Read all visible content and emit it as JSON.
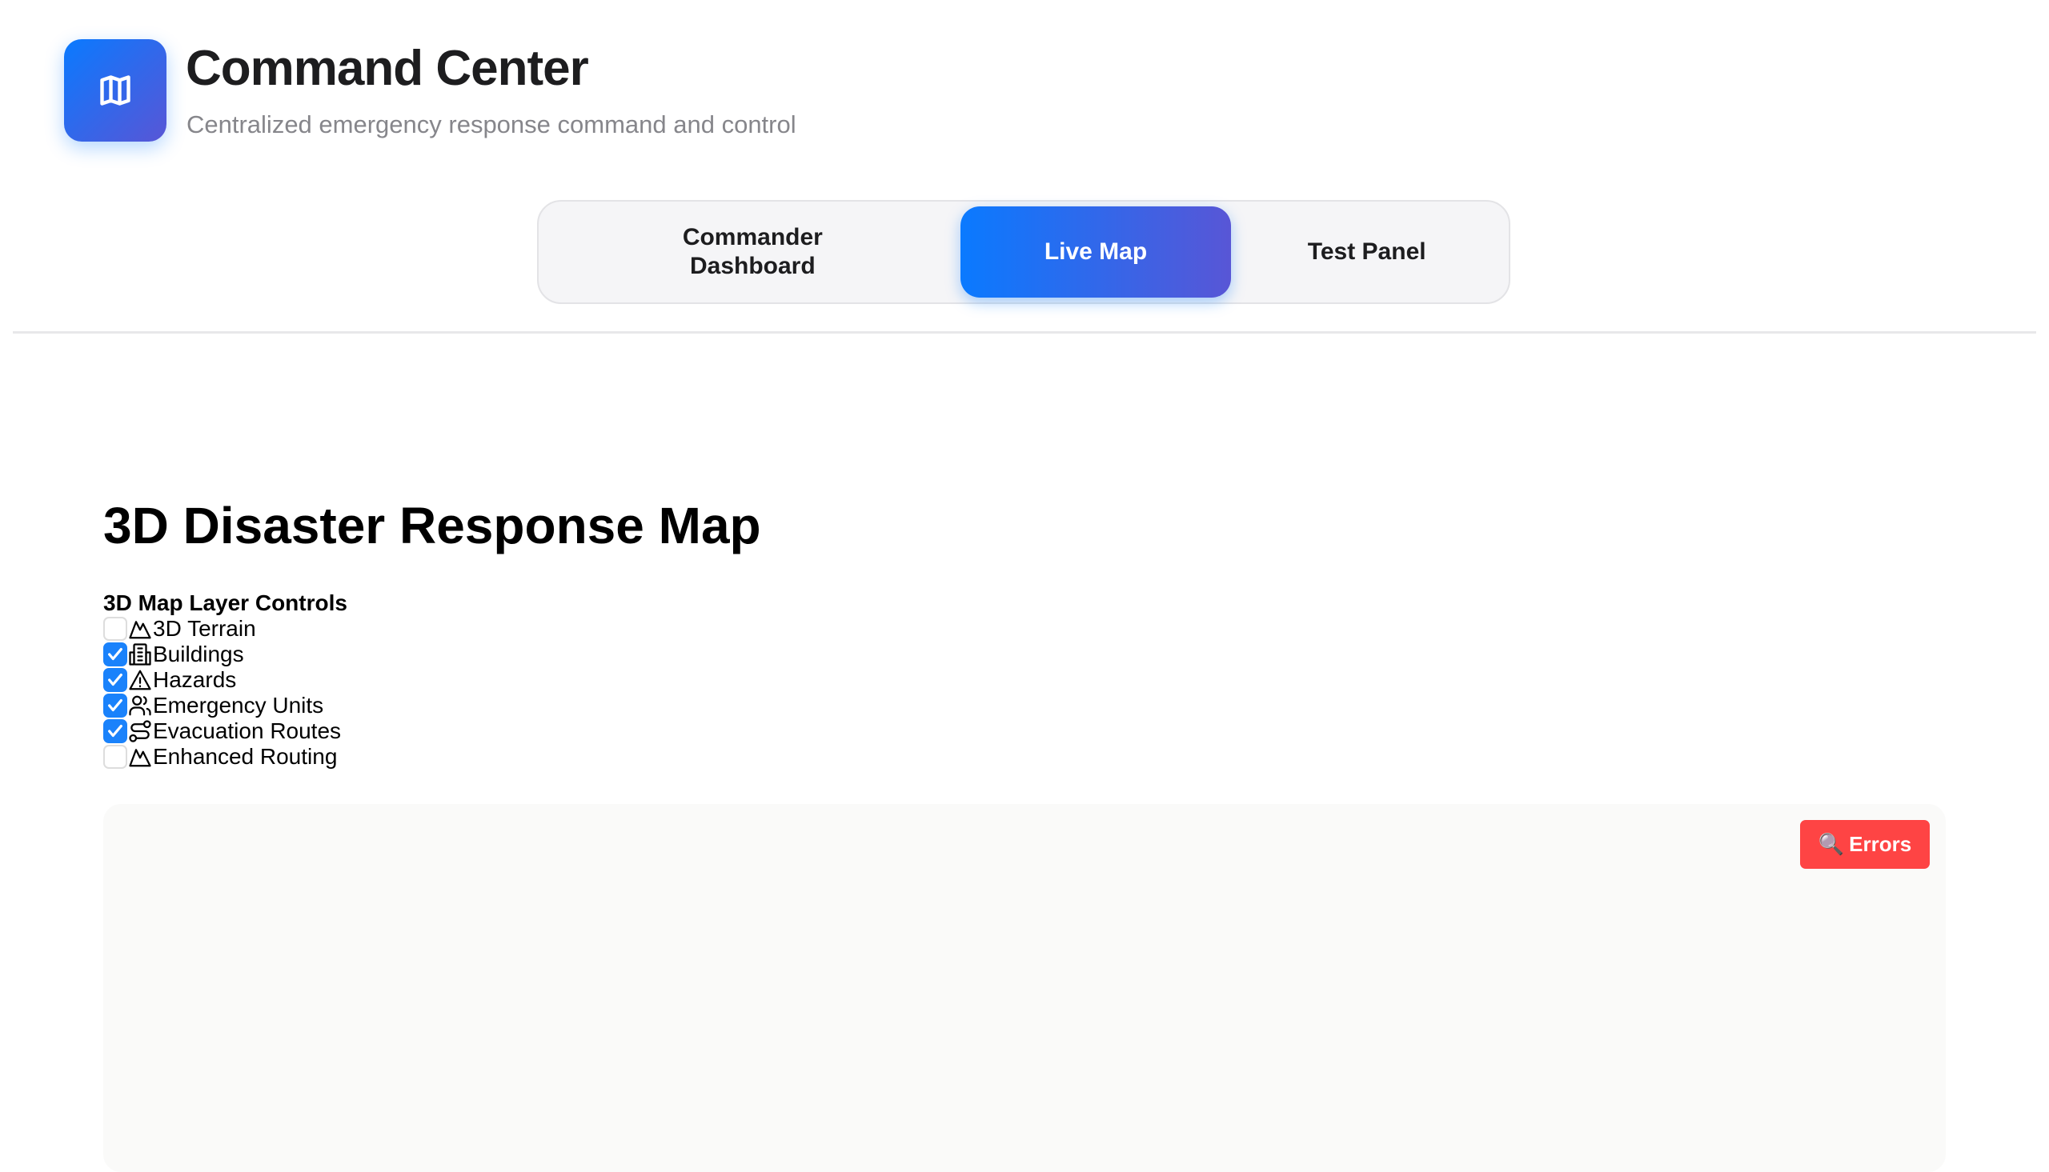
{
  "header": {
    "title": "Command Center",
    "subtitle": "Centralized emergency response command and control",
    "logo_icon": "map-icon"
  },
  "tabs": [
    {
      "label": "Commander Dashboard",
      "active": false
    },
    {
      "label": "Live Map",
      "active": true
    },
    {
      "label": "Test Panel",
      "active": false
    }
  ],
  "main": {
    "heading": "3D Disaster Response Map",
    "layer_controls": {
      "title": "3D Map Layer Controls",
      "layers": [
        {
          "label": "3D Terrain",
          "checked": false,
          "icon": "mountain-icon"
        },
        {
          "label": "Buildings",
          "checked": true,
          "icon": "building-icon"
        },
        {
          "label": "Hazards",
          "checked": true,
          "icon": "warning-icon"
        },
        {
          "label": "Emergency Units",
          "checked": true,
          "icon": "users-icon"
        },
        {
          "label": "Evacuation Routes",
          "checked": true,
          "icon": "route-icon"
        },
        {
          "label": "Enhanced Routing",
          "checked": false,
          "icon": "mountain-icon"
        }
      ]
    },
    "map": {
      "errors_button": {
        "icon": "🔍",
        "label": "Errors"
      }
    }
  },
  "colors": {
    "accent": "#0a7aff",
    "accent2": "#5856d6",
    "error": "#fe4444",
    "checkbox": "#1a82fb"
  }
}
